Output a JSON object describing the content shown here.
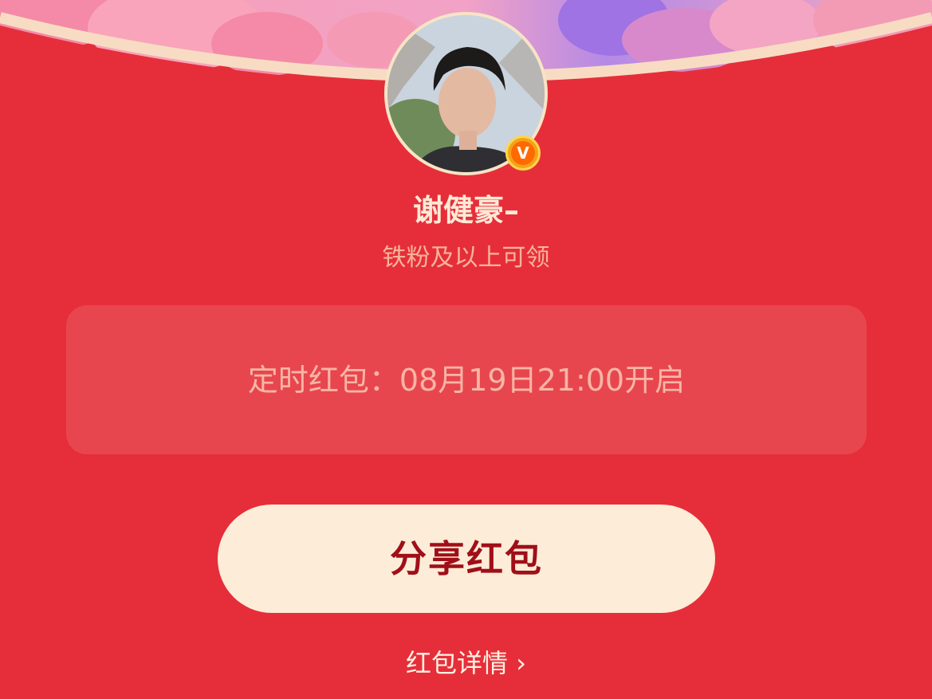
{
  "header": {
    "decoration": "rose-flowers-banner"
  },
  "sender": {
    "name": "谢健豪–",
    "requirement": "铁粉及以上可领",
    "verified_badge": "V"
  },
  "timer": {
    "label": "定时红包：",
    "time": "08月19日21:00开启"
  },
  "actions": {
    "share_label": "分享红包",
    "details_label": "红包详情",
    "details_arrow": "›"
  },
  "colors": {
    "background": "#e62e3a",
    "button": "#fdecd8",
    "button_text": "#a00f18",
    "verified_badge": "#ff6a00"
  }
}
